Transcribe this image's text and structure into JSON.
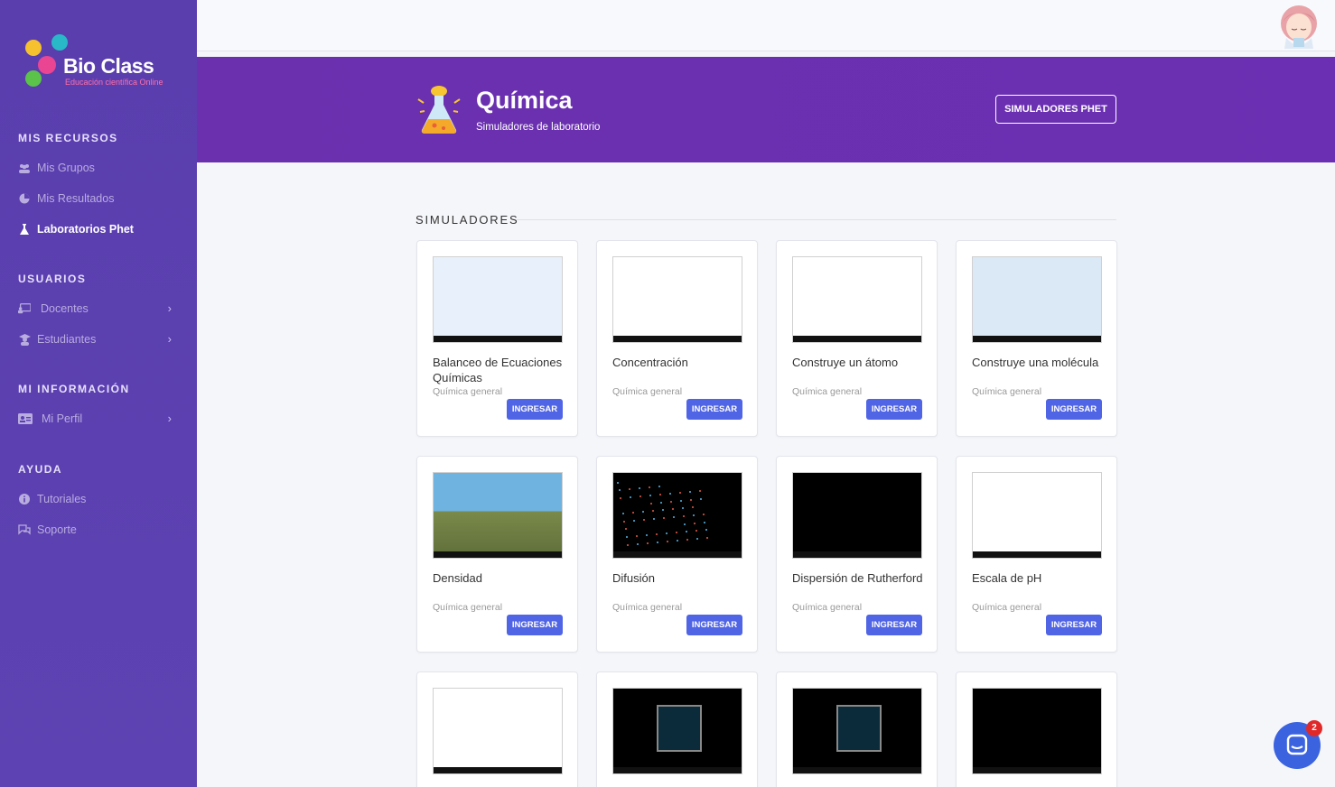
{
  "brand": {
    "name": "Bio Class",
    "tagline": "Educación científica Online"
  },
  "sidebar": {
    "sections": [
      {
        "title": "MIS RECURSOS"
      },
      {
        "title": "USUARIOS"
      },
      {
        "title": "MI INFORMACIÓN"
      },
      {
        "title": "AYUDA"
      }
    ],
    "items": [
      {
        "label": "Mis Grupos",
        "icon": "users-icon",
        "active": false
      },
      {
        "label": "Mis Resultados",
        "icon": "pie-chart-icon",
        "active": false
      },
      {
        "label": "Laboratorios Phet",
        "icon": "flask-icon",
        "active": true
      },
      {
        "label": "Docentes",
        "icon": "chalkboard-icon",
        "active": false
      },
      {
        "label": "Estudiantes",
        "icon": "student-icon",
        "active": false
      },
      {
        "label": "Mi Perfil",
        "icon": "id-card-icon",
        "active": false
      },
      {
        "label": "Tutoriales",
        "icon": "info-icon",
        "active": false
      },
      {
        "label": "Soporte",
        "icon": "chat-icon",
        "active": false
      }
    ]
  },
  "header": {
    "title": "Química",
    "subtitle": "Simuladores de laboratorio",
    "button": "SIMULADORES PHET"
  },
  "section_label": "SIMULADORES",
  "cards": [
    {
      "title": "Balanceo de Ecuaciones Químicas",
      "category": "Química general",
      "button": "INGRESAR"
    },
    {
      "title": "Concentración",
      "category": "Química general",
      "button": "INGRESAR"
    },
    {
      "title": "Construye un átomo",
      "category": "Química general",
      "button": "INGRESAR"
    },
    {
      "title": "Construye una molécula",
      "category": "Química general",
      "button": "INGRESAR"
    },
    {
      "title": "Densidad",
      "category": "Química general",
      "button": "INGRESAR"
    },
    {
      "title": "Difusión",
      "category": "Química general",
      "button": "INGRESAR"
    },
    {
      "title": "Dispersión de Rutherford",
      "category": "Química general",
      "button": "INGRESAR"
    },
    {
      "title": "Escala de pH",
      "category": "Química general",
      "button": "INGRESAR"
    },
    {
      "title": "",
      "category": "",
      "button": ""
    },
    {
      "title": "",
      "category": "",
      "button": ""
    },
    {
      "title": "",
      "category": "",
      "button": ""
    },
    {
      "title": "",
      "category": "",
      "button": ""
    }
  ],
  "chat": {
    "badge": "2"
  },
  "colors": {
    "sidebar": "#5b3fb0",
    "band": "#6a30ae",
    "button": "#5064e6"
  }
}
